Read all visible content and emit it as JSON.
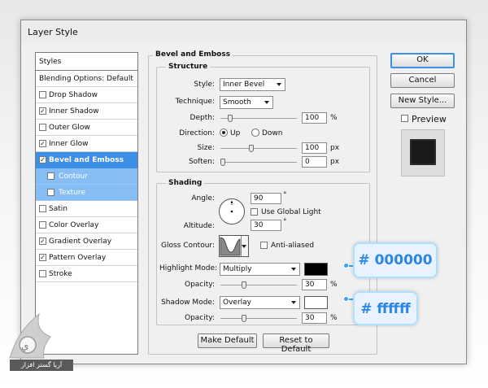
{
  "dialog": {
    "title": "Layer Style"
  },
  "styles_panel": {
    "header": "Styles",
    "items": [
      {
        "label": "Blending Options: Default",
        "has_checkbox": false,
        "checked": false
      },
      {
        "label": "Drop Shadow",
        "has_checkbox": true,
        "checked": false
      },
      {
        "label": "Inner Shadow",
        "has_checkbox": true,
        "checked": true
      },
      {
        "label": "Outer Glow",
        "has_checkbox": true,
        "checked": false
      },
      {
        "label": "Inner Glow",
        "has_checkbox": true,
        "checked": true
      },
      {
        "label": "Bevel and Emboss",
        "has_checkbox": true,
        "checked": true,
        "selected": true
      },
      {
        "label": "Contour",
        "has_checkbox": true,
        "checked": false,
        "sub": true
      },
      {
        "label": "Texture",
        "has_checkbox": true,
        "checked": false,
        "sub": true
      },
      {
        "label": "Satin",
        "has_checkbox": true,
        "checked": false
      },
      {
        "label": "Color Overlay",
        "has_checkbox": true,
        "checked": false
      },
      {
        "label": "Gradient Overlay",
        "has_checkbox": true,
        "checked": true
      },
      {
        "label": "Pattern Overlay",
        "has_checkbox": true,
        "checked": true
      },
      {
        "label": "Stroke",
        "has_checkbox": true,
        "checked": false
      }
    ]
  },
  "bevel": {
    "section_title": "Bevel and Emboss",
    "structure": {
      "title": "Structure",
      "style_label": "Style:",
      "style_value": "Inner Bevel",
      "technique_label": "Technique:",
      "technique_value": "Smooth",
      "depth_label": "Depth:",
      "depth_value": "100",
      "depth_unit": "%",
      "depth_level": 0.1,
      "direction_label": "Direction:",
      "direction_up": "Up",
      "direction_down": "Down",
      "direction_selected": "Up",
      "size_label": "Size:",
      "size_value": "100",
      "size_unit": "px",
      "size_level": 0.4,
      "soften_label": "Soften:",
      "soften_value": "0",
      "soften_unit": "px",
      "soften_level": 0.0
    },
    "shading": {
      "title": "Shading",
      "angle_label": "Angle:",
      "angle_value": "90",
      "angle_unit": "°",
      "use_global_light_label": "Use Global Light",
      "use_global_light_checked": false,
      "altitude_label": "Altitude:",
      "altitude_value": "30",
      "altitude_unit": "°",
      "gloss_contour_label": "Gloss Contour:",
      "anti_aliased_label": "Anti-aliased",
      "anti_aliased_checked": false,
      "highlight_mode_label": "Highlight Mode:",
      "highlight_mode_value": "Multiply",
      "highlight_color": "#000000",
      "highlight_opacity_label": "Opacity:",
      "highlight_opacity_value": "30",
      "highlight_opacity_unit": "%",
      "highlight_opacity_level": 0.3,
      "shadow_mode_label": "Shadow Mode:",
      "shadow_mode_value": "Overlay",
      "shadow_color": "#ffffff",
      "shadow_opacity_label": "Opacity:",
      "shadow_opacity_value": "30",
      "shadow_opacity_unit": "%",
      "shadow_opacity_level": 0.3
    },
    "make_default": "Make Default",
    "reset_to_default": "Reset to Default"
  },
  "actions": {
    "ok": "OK",
    "cancel": "Cancel",
    "new_style": "New Style...",
    "preview_label": "Preview",
    "preview_checked": false
  },
  "annotations": {
    "highlight_hex": "# 000000",
    "shadow_hex": "# ffffff",
    "accent_color": "#2b86e6"
  },
  "watermark": {
    "text": "آریا گستر افزار"
  },
  "colors": {
    "selected_row": "#3b8fe6",
    "sub_row": "#86bdf5",
    "dialog_bg": "#f0f0f0"
  }
}
